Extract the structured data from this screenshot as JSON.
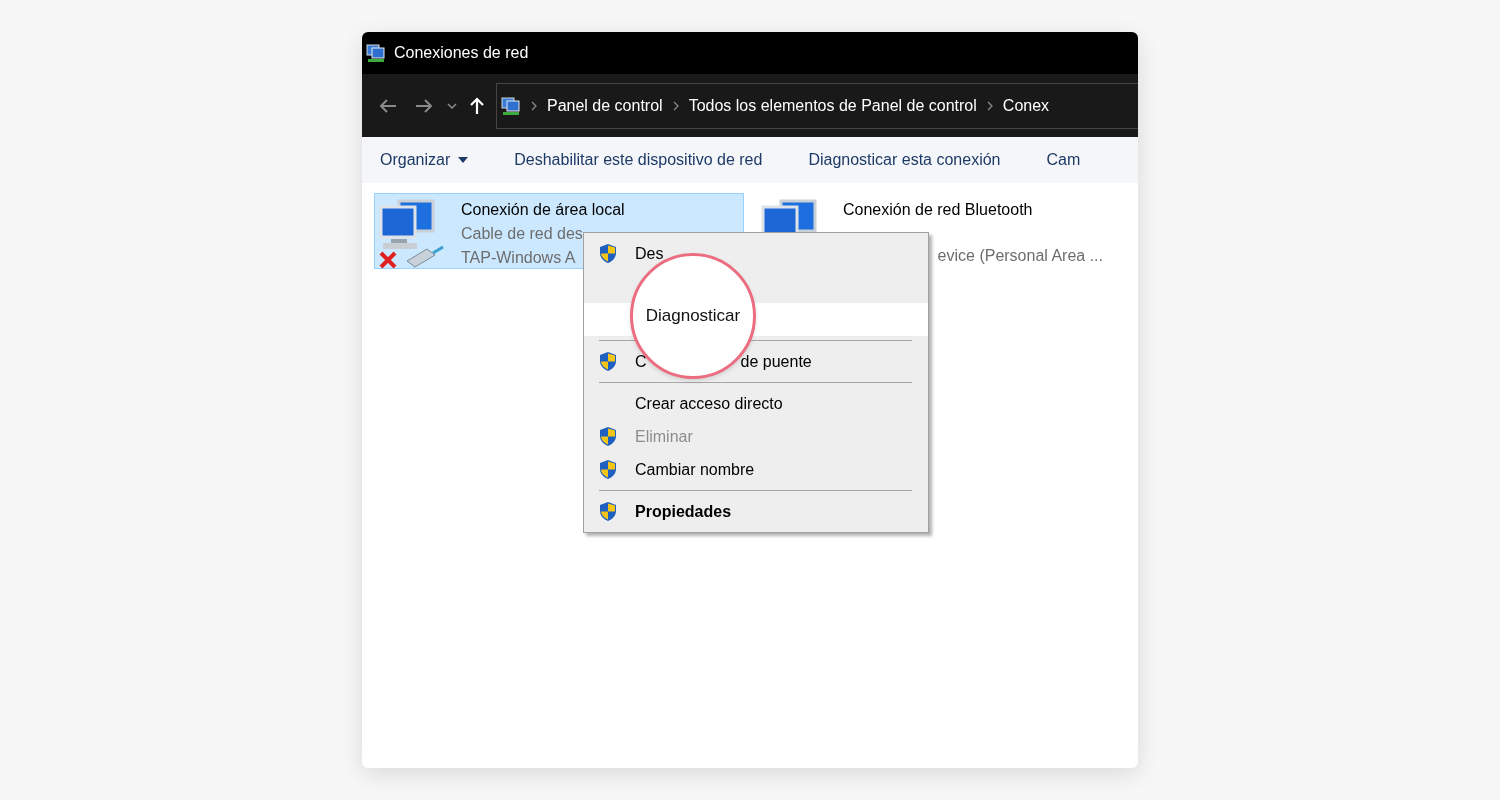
{
  "window": {
    "title": "Conexiones de red"
  },
  "address": {
    "crumbs": [
      "Panel de control",
      "Todos los elementos de Panel de control",
      "Conex"
    ]
  },
  "toolbar": [
    {
      "label": "Organizar",
      "dropdown": true
    },
    {
      "label": "Deshabilitar este dispositivo de red",
      "dropdown": false
    },
    {
      "label": "Diagnosticar esta conexión",
      "dropdown": false
    },
    {
      "label": "Cam",
      "dropdown": false
    }
  ],
  "connections": [
    {
      "name": "Conexión de área local",
      "status": "Cable de red des",
      "device": "TAP-Windows A",
      "selected": true,
      "disconnected": true
    },
    {
      "name": "Conexión de red Bluetooth",
      "device": "evice (Personal Area ...",
      "selected": false,
      "disconnected": false
    }
  ],
  "context_menu": {
    "items": [
      {
        "kind": "item",
        "parts": [
          "Des"
        ],
        "shield": true,
        "disabled": false,
        "default": false,
        "selected": false
      },
      {
        "kind": "blank"
      },
      {
        "kind": "highlight"
      },
      {
        "kind": "separator"
      },
      {
        "kind": "item",
        "parts": [
          "C",
          "de puente"
        ],
        "shield": true,
        "disabled": false,
        "default": false,
        "selected": false
      },
      {
        "kind": "separator"
      },
      {
        "kind": "item",
        "parts": [
          "Crear acceso directo"
        ],
        "shield": false,
        "disabled": false,
        "default": false,
        "selected": false
      },
      {
        "kind": "item",
        "parts": [
          "Eliminar"
        ],
        "shield": true,
        "disabled": true,
        "default": false,
        "selected": false
      },
      {
        "kind": "item",
        "parts": [
          "Cambiar nombre"
        ],
        "shield": true,
        "disabled": false,
        "default": false,
        "selected": false
      },
      {
        "kind": "separator"
      },
      {
        "kind": "item",
        "parts": [
          "Propiedades"
        ],
        "shield": true,
        "disabled": false,
        "default": true,
        "selected": false
      }
    ]
  },
  "magnifier": {
    "text": "Diagnosticar"
  }
}
